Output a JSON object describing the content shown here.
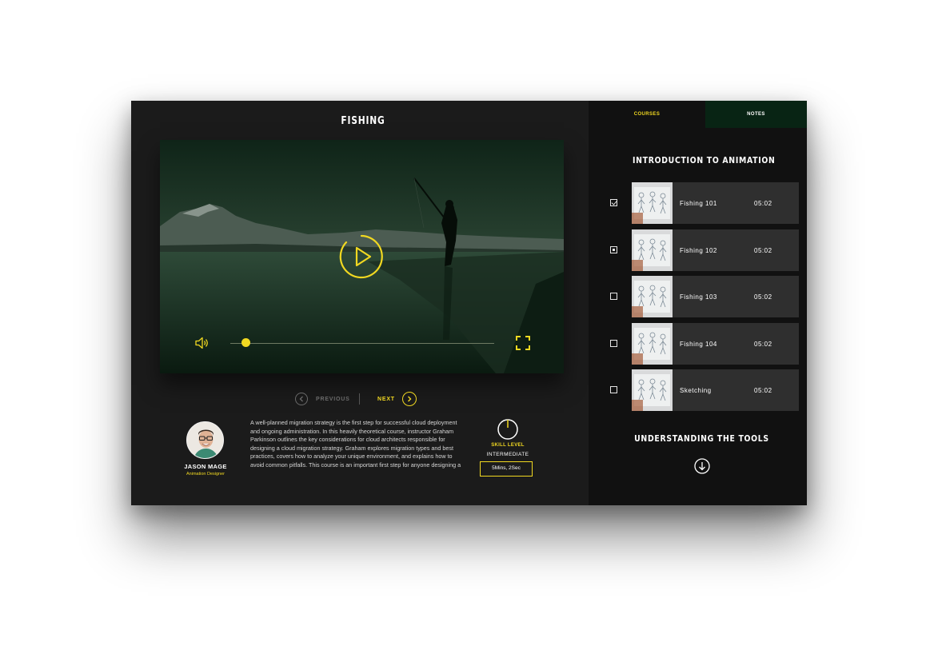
{
  "video": {
    "title": "FISHING",
    "progress_fraction": 0.06
  },
  "navigation": {
    "previous_label": "PREVIOUS",
    "next_label": "NEXT"
  },
  "author": {
    "name": "JASON MAGE",
    "role": "Animation Designer"
  },
  "description": "A well-planned migration strategy is the first step for successful cloud deployment and ongoing administration. In this heavily theoretical course, instructor Graham Parkinson outlines the key considerations for cloud architects responsible for designing a cloud migration strategy. Graham explores migration types and best practices, covers how to analyze your unique environment, and explains how to avoid common pitfalls. This course is an important first step for anyone designing a",
  "skill": {
    "label": "SKILL LEVEL",
    "value": "INTERMEDIATE",
    "duration": "5Mins, 2Sec"
  },
  "sidebar": {
    "tabs": [
      {
        "label": "COURSES",
        "active": true
      },
      {
        "label": "NOTES",
        "active": false
      }
    ],
    "section_title": "INTRODUCTION TO ANIMATION",
    "lessons": [
      {
        "title": "Fishing 101",
        "time": "05:02",
        "state": "checked"
      },
      {
        "title": "Fishing 102",
        "time": "05:02",
        "state": "current"
      },
      {
        "title": "Fishing 103",
        "time": "05:02",
        "state": "unchecked"
      },
      {
        "title": "Fishing 104",
        "time": "05:02",
        "state": "unchecked"
      },
      {
        "title": "Sketching",
        "time": "05:02",
        "state": "unchecked"
      }
    ],
    "next_section_title": "UNDERSTANDING THE TOOLS"
  },
  "colors": {
    "accent": "#f1d821",
    "panel": "#1b1b1b",
    "sidebar": "#111111",
    "notes_tab": "#082414",
    "card": "#2f2f2f"
  },
  "icons": {
    "play": "play-icon",
    "volume": "volume-icon",
    "fullscreen": "fullscreen-icon",
    "previous": "chevron-left-icon",
    "next": "chevron-right-icon",
    "down": "arrow-down-icon"
  }
}
